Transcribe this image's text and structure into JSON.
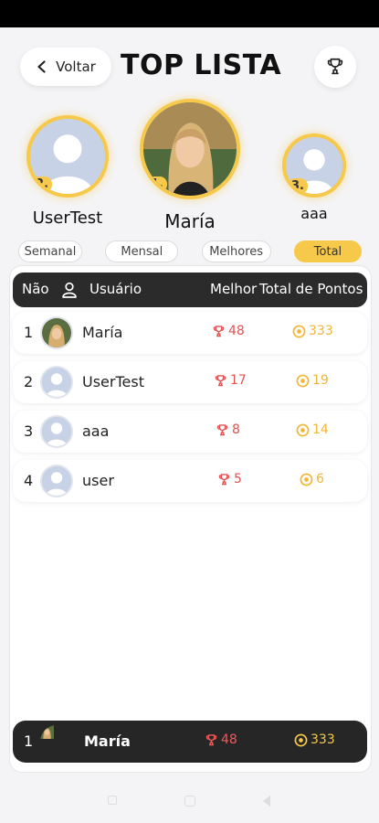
{
  "header": {
    "back_label": "Voltar",
    "title": "TOP LISTA"
  },
  "podium": {
    "first": {
      "rank": "1.",
      "name": "María"
    },
    "second": {
      "rank": "2.",
      "name": "UserTest"
    },
    "third": {
      "rank": "3.",
      "name": "aaa"
    }
  },
  "tabs": [
    {
      "label": "Semanal",
      "active": false
    },
    {
      "label": "Mensal",
      "active": false
    },
    {
      "label": "Melhores",
      "active": false
    },
    {
      "label": "Total",
      "active": true
    }
  ],
  "table": {
    "columns": {
      "rank": "Não",
      "user": "Usuário",
      "best": "Melhor",
      "total": "Total de Pontos"
    },
    "rows": [
      {
        "rank": "1",
        "name": "María",
        "best": "48",
        "points": "333",
        "photo": true
      },
      {
        "rank": "2",
        "name": "UserTest",
        "best": "17",
        "points": "19",
        "photo": false
      },
      {
        "rank": "3",
        "name": "aaa",
        "best": "8",
        "points": "14",
        "photo": false
      },
      {
        "rank": "4",
        "name": "user",
        "best": "5",
        "points": "6",
        "photo": false
      }
    ]
  },
  "current_user": {
    "rank": "1",
    "name": "María",
    "best": "48",
    "points": "333"
  },
  "colors": {
    "gold": "#f7c94a",
    "trophy_red": "#e05252",
    "dark": "#2b2b2b",
    "placeholder": "#c8d2e6"
  },
  "icons": [
    "chevron-left-icon",
    "trophy-icon",
    "user-icon",
    "coin-icon",
    "person-placeholder-icon"
  ]
}
